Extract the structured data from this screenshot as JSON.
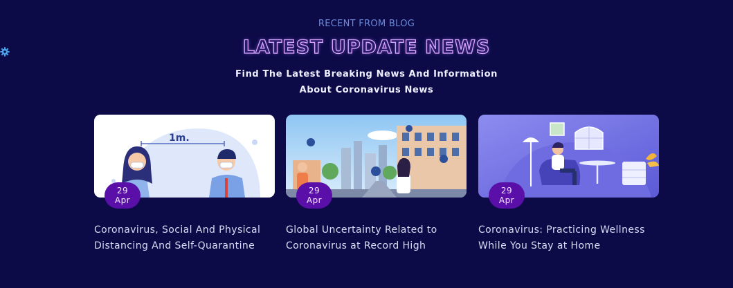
{
  "section": {
    "eyebrow": "RECENT FROM BLOG",
    "title": "LATEST UPDATE NEWS",
    "subtitle_line1": "Find The Latest Breaking News And Information",
    "subtitle_line2": "About Coronavirus News"
  },
  "posts": [
    {
      "day": "29",
      "month": "Apr",
      "title": "Coronavirus, Social And Physical Distancing And Self-Quarantine",
      "image_label": "1m.",
      "image_icon": "social-distancing-illustration"
    },
    {
      "day": "29",
      "month": "Apr",
      "title": "Global Uncertainty Related to Coronavirus at Record High",
      "image_icon": "city-street-virus-illustration"
    },
    {
      "day": "29",
      "month": "Apr",
      "title": "Coronavirus: Practicing Wellness While You Stay at Home",
      "image_icon": "stay-home-illustration"
    }
  ],
  "colors": {
    "background": "#0c0b48",
    "badge": "#5a10a8",
    "eyebrow": "#6c8ad8",
    "title_outline": "#d9a6ff"
  }
}
